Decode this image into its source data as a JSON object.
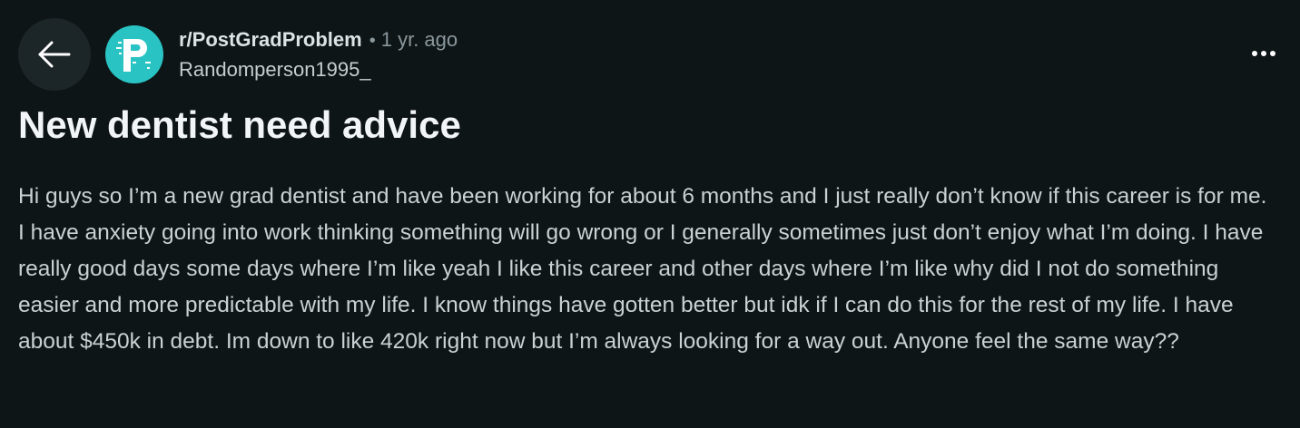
{
  "post": {
    "subreddit": "r/PostGradProblem",
    "separator": "•",
    "timestamp": "1 yr. ago",
    "author": "Randomperson1995_",
    "title": "New dentist need advice",
    "body": "Hi guys so I’m a new grad dentist and have been working for about 6 months and I just really don’t know if this career is for me. I have anxiety going into work thinking something will go wrong or I generally sometimes just don’t enjoy what I’m doing. I have really good days some days where I’m like yeah I like this career and other days where I’m like why did I not do something easier and more predictable with my life. I know things have gotten better but idk if I can do this for the rest of my life. I have about $450k in debt. Im down to like 420k right now but I’m always looking for a way out. Anyone feel the same way??"
  },
  "icons": {
    "back": "arrow-left-icon",
    "avatar": "subreddit-p-logo",
    "more": "ellipsis-horizontal-icon"
  },
  "colors": {
    "background": "#0e1517",
    "avatar": "#2ac3c4",
    "back_button_bg": "#1c2528",
    "muted_text": "#8a989d"
  }
}
